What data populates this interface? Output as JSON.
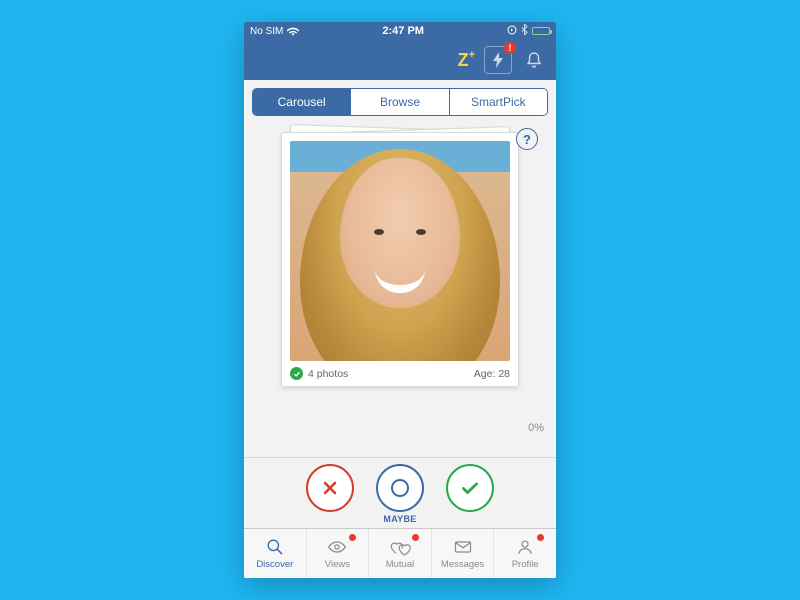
{
  "statusbar": {
    "left_text": "No SIM",
    "time": "2:47 PM"
  },
  "navbar": {
    "logo_letter": "Z",
    "logo_plus": "+",
    "boost_badge": "!"
  },
  "segmented": {
    "items": [
      {
        "label": "Carousel",
        "active": true
      },
      {
        "label": "Browse",
        "active": false
      },
      {
        "label": "SmartPick",
        "active": false
      }
    ]
  },
  "help_symbol": "?",
  "card": {
    "photos_count": "4 photos",
    "age_label": "Age: 28"
  },
  "progress_label": "0%",
  "actions": {
    "maybe_label": "MAYBE"
  },
  "tabs": [
    {
      "label": "Discover",
      "active": true,
      "dot": false
    },
    {
      "label": "Views",
      "active": false,
      "dot": true
    },
    {
      "label": "Mutual",
      "active": false,
      "dot": true
    },
    {
      "label": "Messages",
      "active": false,
      "dot": false
    },
    {
      "label": "Profile",
      "active": false,
      "dot": true
    }
  ]
}
